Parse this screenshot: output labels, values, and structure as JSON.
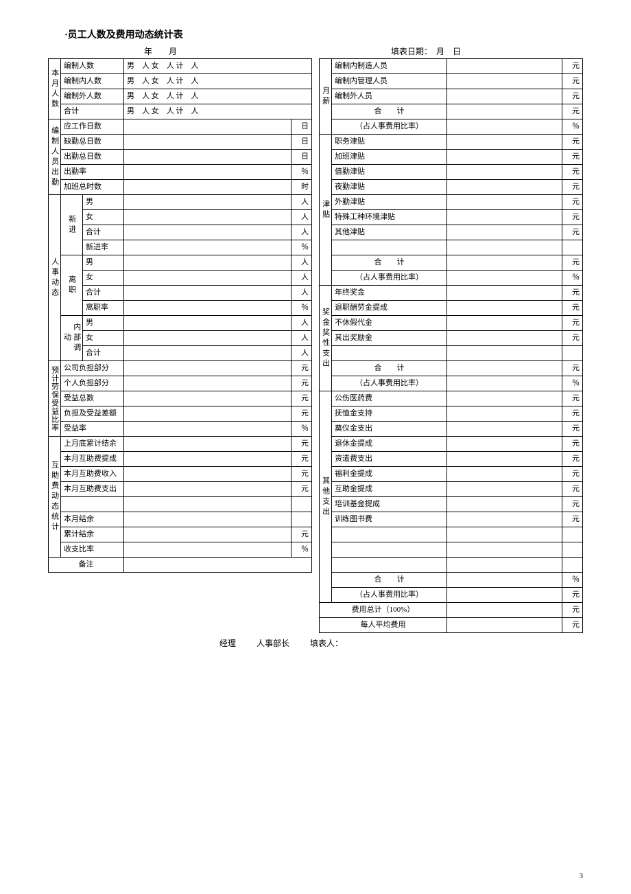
{
  "title": "·员工人数及费用动态统计表",
  "header": {
    "year_month": "年　　月",
    "fill_date": "填表日期：　月　日"
  },
  "left": {
    "sec1": {
      "side": "本月人数",
      "rows": [
        {
          "label": "编制人数",
          "detail": "男　人 女　人 计　人"
        },
        {
          "label": "编制内人数",
          "detail": "男　人 女　人 计　人"
        },
        {
          "label": "编制外人数",
          "detail": "男　人 女　人 计　人"
        },
        {
          "label": "合计",
          "detail": "男　人 女　人 计　人"
        }
      ]
    },
    "sec2": {
      "side": "编制人员出勤",
      "rows": [
        {
          "label": "应工作日数",
          "unit": "日"
        },
        {
          "label": "缺勤总日数",
          "unit": "日"
        },
        {
          "label": "出勤总日数",
          "unit": "日"
        },
        {
          "label": "出勤率",
          "unit": "％"
        },
        {
          "label": "加班总时数",
          "unit": "时"
        }
      ]
    },
    "sec3": {
      "side": "人事动态",
      "groups": [
        {
          "side": "新进",
          "rows": [
            {
              "label": "男",
              "unit": "人"
            },
            {
              "label": "女",
              "unit": "人"
            },
            {
              "label": "合计",
              "unit": "人"
            },
            {
              "label": "新进率",
              "unit": "％"
            }
          ]
        },
        {
          "side": "离职",
          "rows": [
            {
              "label": "男",
              "unit": "人"
            },
            {
              "label": "女",
              "unit": "人"
            },
            {
              "label": "合计",
              "unit": "人"
            },
            {
              "label": "离职率",
              "unit": "％"
            }
          ]
        },
        {
          "side": "内部调动",
          "rows": [
            {
              "label": "男",
              "unit": "人"
            },
            {
              "label": "女",
              "unit": "人"
            },
            {
              "label": "合计",
              "unit": "人"
            }
          ]
        }
      ]
    },
    "sec4": {
      "side": "预计劳保受益比率",
      "rows": [
        {
          "label": "公司负担部分",
          "unit": "元"
        },
        {
          "label": "个人负担部分",
          "unit": "元"
        },
        {
          "label": "受益总数",
          "unit": "元"
        },
        {
          "label": "负担及受益差额",
          "unit": "元"
        },
        {
          "label": "受益率",
          "unit": "％"
        }
      ]
    },
    "sec5": {
      "side": "互助费动态统计",
      "rows": [
        {
          "label": "上月底累计结余",
          "unit": "元"
        },
        {
          "label": "本月互助费提成",
          "unit": "元"
        },
        {
          "label": "本月互助费收入",
          "unit": "元"
        },
        {
          "label": "本月互助费支出",
          "unit": "元"
        },
        {
          "label": "",
          "unit": ""
        },
        {
          "label": "本月结余",
          "unit": ""
        },
        {
          "label": "累计结余",
          "unit": "元"
        },
        {
          "label": "收支比率",
          "unit": "％"
        }
      ]
    },
    "remark": "备注"
  },
  "right": {
    "sec1": {
      "side": "月薪",
      "rows": [
        {
          "label": "编制内制造人员",
          "unit": "元"
        },
        {
          "label": "编制内管理人员",
          "unit": "元"
        },
        {
          "label": "编制外人员",
          "unit": "元"
        },
        {
          "label": "合　　计",
          "unit": "元"
        },
        {
          "label": "（占人事费用比率）",
          "unit": "％"
        }
      ]
    },
    "sec2": {
      "side": "津贴",
      "rows": [
        {
          "label": "职务津贴",
          "unit": "元"
        },
        {
          "label": "加班津贴",
          "unit": "元"
        },
        {
          "label": "值勤津贴",
          "unit": "元"
        },
        {
          "label": "夜勤津贴",
          "unit": "元"
        },
        {
          "label": "外勤津贴",
          "unit": "元"
        },
        {
          "label": "特殊工种环境津贴",
          "unit": "元"
        },
        {
          "label": "其他津贴",
          "unit": "元"
        },
        {
          "label": "",
          "unit": ""
        },
        {
          "label": "合　　计",
          "unit": "元"
        },
        {
          "label": "（占人事费用比率）",
          "unit": "％"
        }
      ]
    },
    "sec3": {
      "side": "奖金奖性支出",
      "rows": [
        {
          "label": "年终奖金",
          "unit": "元"
        },
        {
          "label": "退职酬劳金提成",
          "unit": "元"
        },
        {
          "label": "不休假代金",
          "unit": "元"
        },
        {
          "label": "其出奖励金",
          "unit": "元"
        },
        {
          "label": "",
          "unit": ""
        },
        {
          "label": "合　　计",
          "unit": "元"
        },
        {
          "label": "（占人事费用比率）",
          "unit": "％"
        }
      ]
    },
    "sec4": {
      "side": "其他支出",
      "rows": [
        {
          "label": "公伤医药费",
          "unit": "元"
        },
        {
          "label": "抚恤金支持",
          "unit": "元"
        },
        {
          "label": "奠仪金支出",
          "unit": "元"
        },
        {
          "label": "退休金提成",
          "unit": "元"
        },
        {
          "label": "资遣费支出",
          "unit": "元"
        },
        {
          "label": "福利金提成",
          "unit": "元"
        },
        {
          "label": "互助金提成",
          "unit": "元"
        },
        {
          "label": "培训基金提成",
          "unit": "元"
        },
        {
          "label": "训练图书费",
          "unit": "元"
        },
        {
          "label": "",
          "unit": ""
        },
        {
          "label": "",
          "unit": ""
        },
        {
          "label": "",
          "unit": ""
        },
        {
          "label": "合　　计",
          "unit": "％"
        },
        {
          "label": "（占人事费用比率）",
          "unit": "元"
        }
      ]
    },
    "totals": [
      {
        "label": "费用总计（100%）",
        "unit": "元"
      },
      {
        "label": "每人平均费用",
        "unit": "元"
      }
    ]
  },
  "footer": {
    "manager": "经理",
    "hr_head": "人事部长",
    "filler": "填表人："
  },
  "page": "3"
}
